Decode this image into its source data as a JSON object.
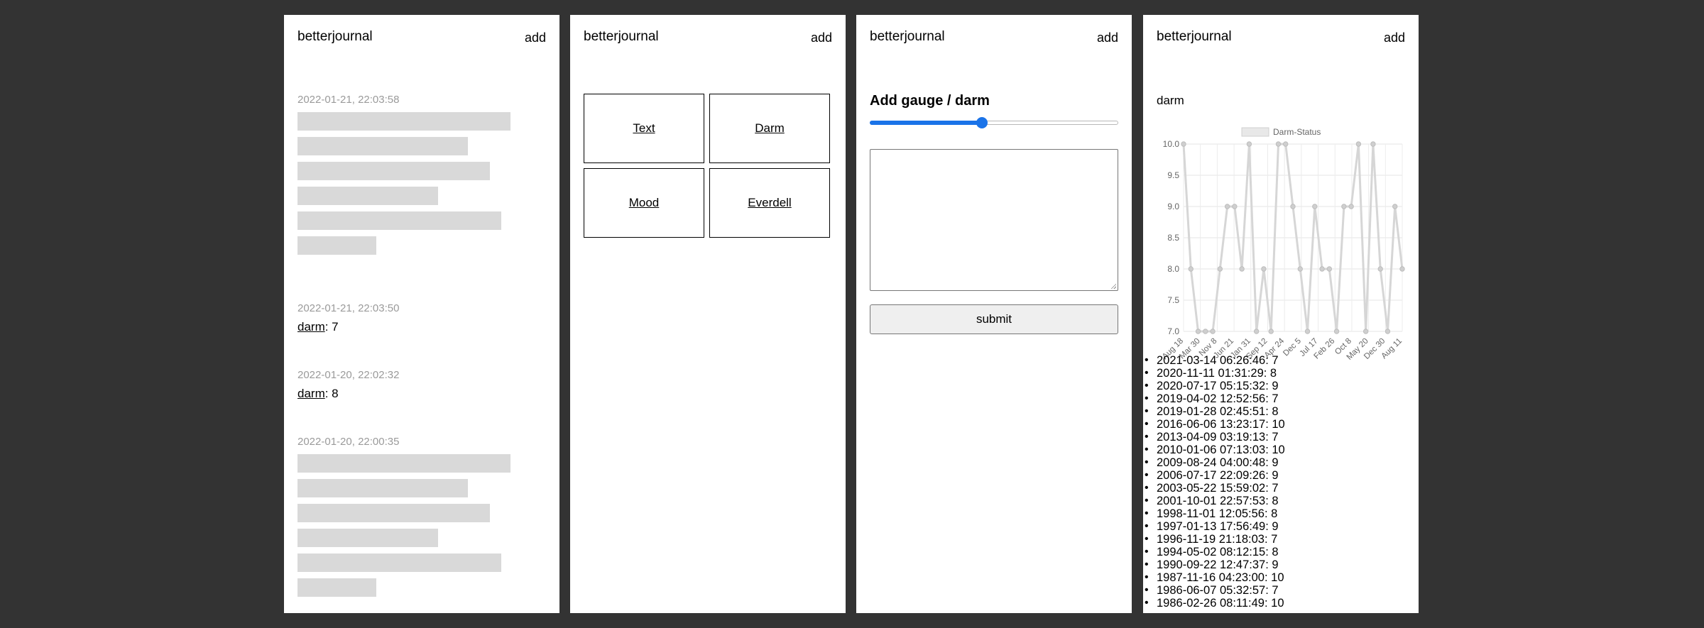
{
  "header": {
    "title": "betterjournal",
    "add_label": "add"
  },
  "feed": {
    "entries": [
      {
        "timestamp": "2022-01-21, 22:03:58",
        "type": "text",
        "redacted_lines": [
          300,
          240,
          271,
          198,
          287,
          111
        ]
      },
      {
        "timestamp": "2022-01-21, 22:03:50",
        "type": "gauge",
        "gauge": "darm",
        "value": ": 7"
      },
      {
        "timestamp": "2022-01-20, 22:02:32",
        "type": "gauge",
        "gauge": "darm",
        "value": ": 8"
      },
      {
        "timestamp": "2022-01-20, 22:00:35",
        "type": "text",
        "redacted_lines": [
          300,
          240,
          271,
          198,
          287,
          111
        ]
      }
    ]
  },
  "add_menu": {
    "tiles": [
      "Text",
      "Darm",
      "Mood",
      "Everdell"
    ]
  },
  "gauge_form": {
    "title": "Add gauge / darm",
    "slider_fraction": 0.45,
    "textarea_value": "",
    "submit_label": "submit"
  },
  "gauge_detail": {
    "name": "darm",
    "history": [
      "2021-03-14 06:26:46: 7",
      "2020-11-11 01:31:29: 8",
      "2020-07-17 05:15:32: 9",
      "2019-04-02 12:52:56: 7",
      "2019-01-28 02:45:51: 8",
      "2016-06-06 13:23:17: 10",
      "2013-04-09 03:19:13: 7",
      "2010-01-06 07:13:03: 10",
      "2009-08-24 04:00:48: 9",
      "2006-07-17 22:09:26: 9",
      "2003-05-22 15:59:02: 7",
      "2001-10-01 22:57:53: 8",
      "1998-11-01 12:05:56: 8",
      "1997-01-13 17:56:49: 9",
      "1996-11-19 21:18:03: 7",
      "1994-05-02 08:12:15: 8",
      "1990-09-22 12:47:37: 9",
      "1987-11-16 04:23:00: 10",
      "1986-06-07 05:32:57: 7",
      "1986-02-26 08:11:49: 10"
    ]
  },
  "chart_data": {
    "type": "line",
    "title": "",
    "xlabel": "",
    "ylabel": "",
    "ylim": [
      7.0,
      10.0
    ],
    "y_ticks": [
      "10.0",
      "9.5",
      "9.0",
      "8.5",
      "8.0",
      "7.5",
      "7.0"
    ],
    "x_tick_labels": [
      "Aug 18",
      "Mar 30",
      "Nov 8",
      "Jun 21",
      "Jan 31",
      "Sep 12",
      "Apr 24",
      "Dec 5",
      "Jul 17",
      "Feb 26",
      "Oct 8",
      "May 20",
      "Dec 30",
      "Aug 11"
    ],
    "legend": {
      "label": "Darm-Status",
      "position": "top"
    },
    "grid": true,
    "line_color": "#d6d6d6",
    "series": [
      {
        "name": "Darm-Status",
        "values": [
          10,
          8,
          7,
          7,
          7,
          8,
          9,
          9,
          8,
          10,
          7,
          8,
          7,
          10,
          10,
          9,
          8,
          7,
          9,
          8,
          8,
          7,
          9,
          9,
          10,
          7,
          10,
          8,
          7,
          9,
          8
        ]
      }
    ]
  }
}
